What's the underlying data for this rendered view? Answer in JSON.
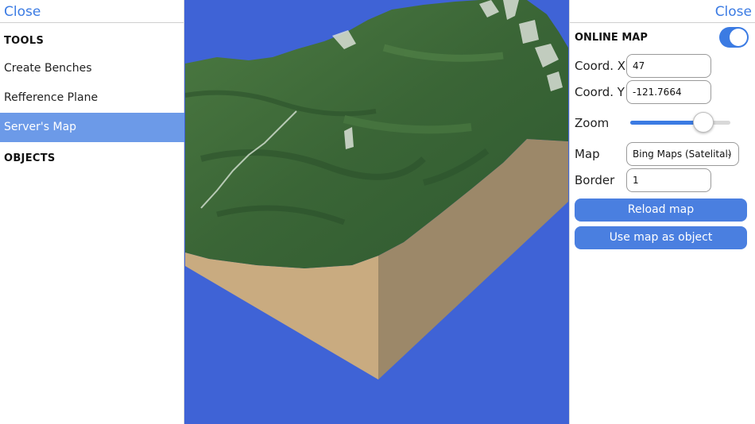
{
  "left_panel": {
    "close_label": "Close",
    "tools_title": "TOOLS",
    "items": [
      {
        "label": "Create Benches",
        "active": false
      },
      {
        "label": "Refference Plane",
        "active": false
      },
      {
        "label": "Server's Map",
        "active": true
      }
    ],
    "objects_title": "OBJECTS"
  },
  "right_panel": {
    "close_label": "Close",
    "online_map_label": "ONLINE MAP",
    "online_map_enabled": true,
    "coord_x_label": "Coord. X",
    "coord_x_value": "47",
    "coord_y_label": "Coord. Y",
    "coord_y_value": "-121.7664",
    "zoom_label": "Zoom",
    "zoom_fraction": 0.73,
    "map_label": "Map",
    "map_selected": "Bing Maps (Satelital)",
    "border_label": "Border",
    "border_value": "1",
    "reload_button": "Reload map",
    "use_map_button": "Use map as object"
  },
  "colors": {
    "accent": "#3b7be3",
    "active_item": "#6c9ae8",
    "viewport_bg": "#3f63d6",
    "terrain_green": "#3f6b3a",
    "terrain_side_light": "#c9ab80",
    "terrain_side_dark": "#9c8869"
  }
}
